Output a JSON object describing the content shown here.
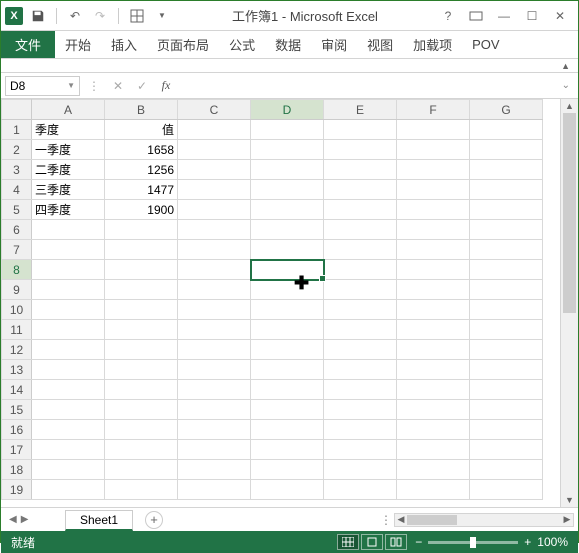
{
  "title": "工作簿1 - Microsoft Excel",
  "ribbon": {
    "file": "文件",
    "tabs": [
      "开始",
      "插入",
      "页面布局",
      "公式",
      "数据",
      "审阅",
      "视图",
      "加载项",
      "POV"
    ]
  },
  "name_box": "D8",
  "columns": [
    "A",
    "B",
    "C",
    "D",
    "E",
    "F",
    "G"
  ],
  "active_col": "D",
  "active_row": 8,
  "row_count": 19,
  "cells": {
    "A1": "季度",
    "B1": "值",
    "A2": "一季度",
    "B2": "1658",
    "A3": "二季度",
    "B3": "1256",
    "A4": "三季度",
    "B4": "1477",
    "A5": "四季度",
    "B5": "1900"
  },
  "sheet_tab": "Sheet1",
  "status": "就绪",
  "zoom": "100%",
  "chart_data": {
    "type": "table",
    "title": "季度 / 值",
    "categories": [
      "一季度",
      "二季度",
      "三季度",
      "四季度"
    ],
    "values": [
      1658,
      1256,
      1477,
      1900
    ],
    "xlabel": "季度",
    "ylabel": "值"
  }
}
